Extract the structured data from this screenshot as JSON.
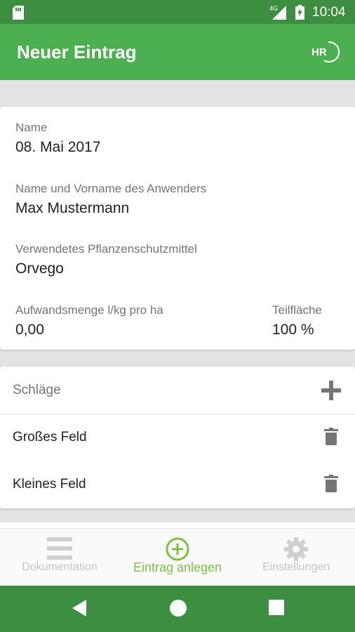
{
  "status_bar": {
    "time": "10:04",
    "network": "4G",
    "icons": [
      "sim-card-icon",
      "signal-icon",
      "battery-charging-icon"
    ]
  },
  "app_bar": {
    "title": "Neuer Eintrag",
    "logo_text": "HR"
  },
  "entry": {
    "name_label": "Name",
    "name_value": "08. Mai 2017",
    "user_label": "Name und Vorname des Anwenders",
    "user_value": "Max Mustermann",
    "pesticide_label": "Verwendetes Pflanzenschutzmittel",
    "pesticide_value": "Orvego",
    "amount_label": "Aufwandsmenge l/kg pro ha",
    "amount_value": "0,00",
    "partial_label": "Teilfläche",
    "partial_value": "100 %"
  },
  "fields": {
    "header": "Schläge",
    "add_icon": "plus-icon",
    "items": [
      {
        "name": "Großes Feld",
        "icon": "trash-icon"
      },
      {
        "name": "Kleines Feld",
        "icon": "trash-icon"
      }
    ]
  },
  "bottom_nav": {
    "items": [
      {
        "label": "Dokumentation",
        "icon": "list-icon",
        "active": false
      },
      {
        "label": "Eintrag anlegen",
        "icon": "add-circle-icon",
        "active": true
      },
      {
        "label": "Einstellungen",
        "icon": "gear-icon",
        "active": false
      }
    ]
  },
  "colors": {
    "status_bar": "#3e8e41",
    "app_bar": "#4caf50",
    "accent": "#7cc142",
    "background": "#e3e3e3"
  },
  "system_nav": {
    "icons": [
      "back-icon",
      "home-icon",
      "recents-icon"
    ]
  }
}
